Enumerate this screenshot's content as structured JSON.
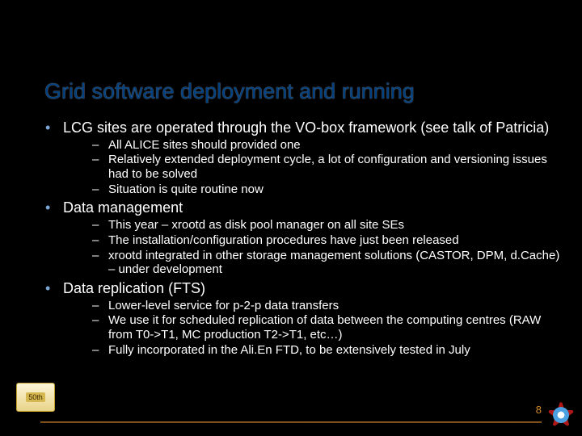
{
  "title": "Grid software deployment and running",
  "bullets": [
    {
      "text": "LCG sites are operated through the VO-box framework (see talk of Patricia)",
      "sub": [
        "All ALICE sites should provided one",
        "Relatively extended deployment cycle, a lot of configuration and versioning issues had to be solved",
        "Situation is quite routine now"
      ]
    },
    {
      "text": "Data management",
      "sub": [
        "This year – xrootd as disk pool manager on all site SEs",
        "The installation/configuration procedures have just been released",
        "xrootd integrated in other storage management solutions (CASTOR, DPM, d.Cache)  – under development"
      ]
    },
    {
      "text": "Data replication (FTS)",
      "sub": [
        "Lower-level service for p-2-p data transfers",
        "We use it for scheduled replication of data between the computing centres (RAW from T0->T1, MC production T2->T1, etc…)",
        "Fully incorporated in the Ali.En FTD, to be extensively tested in July"
      ]
    }
  ],
  "pageNumber": "8",
  "logoLeftText": "50th"
}
